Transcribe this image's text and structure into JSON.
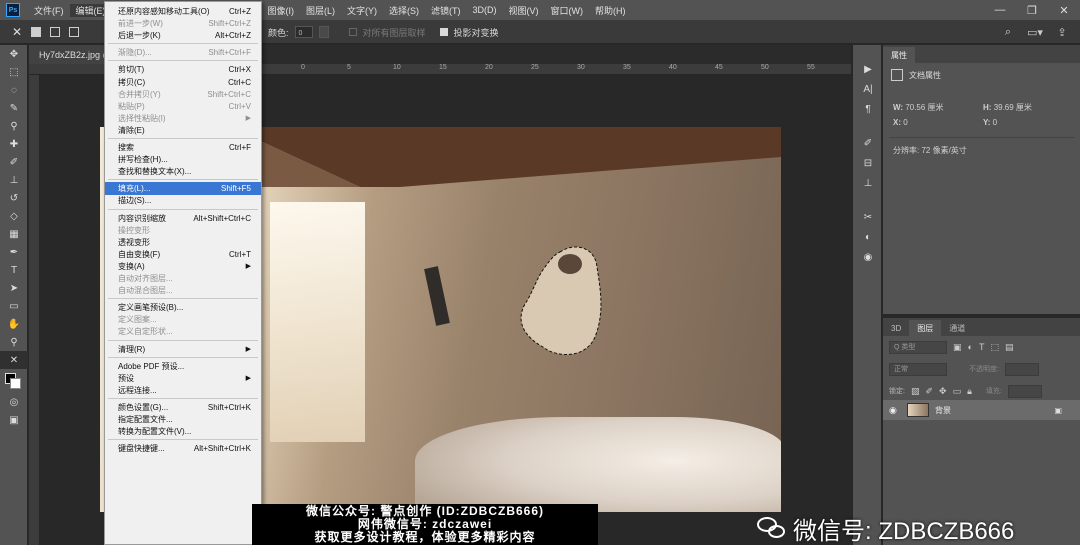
{
  "app": {
    "logo": "Ps"
  },
  "menubar": {
    "items": [
      "文件(F)",
      "编辑(E)",
      "图像(I)",
      "图层(L)",
      "文字(Y)",
      "选择(S)",
      "滤镜(T)",
      "3D(D)",
      "视图(V)",
      "窗口(W)",
      "帮助(H)"
    ],
    "window_controls": [
      "—",
      "❐",
      "✕"
    ]
  },
  "options": {
    "color_label": "颜色:",
    "color_value": "0",
    "sample_all_layers": "对所有图层取样",
    "auto_enhance": "投影对变换"
  },
  "document": {
    "tab_title": "Hy7dxZB2z.jpg @",
    "close": "×"
  },
  "ruler_numbers": [
    "0",
    "5",
    "10",
    "15",
    "20",
    "25",
    "30",
    "35",
    "40",
    "45",
    "50",
    "55",
    "60",
    "65",
    "70"
  ],
  "edit_menu": {
    "items": [
      {
        "label": "还原内容感知移动工具(O)",
        "shortcut": "Ctrl+Z",
        "disabled": false
      },
      {
        "label": "前进一步(W)",
        "shortcut": "Shift+Ctrl+Z",
        "disabled": true
      },
      {
        "label": "后退一步(K)",
        "shortcut": "Alt+Ctrl+Z",
        "disabled": false
      },
      {
        "sep": true
      },
      {
        "label": "渐隐(D)...",
        "shortcut": "Shift+Ctrl+F",
        "disabled": true
      },
      {
        "sep": true
      },
      {
        "label": "剪切(T)",
        "shortcut": "Ctrl+X",
        "disabled": false
      },
      {
        "label": "拷贝(C)",
        "shortcut": "Ctrl+C",
        "disabled": false
      },
      {
        "label": "合并拷贝(Y)",
        "shortcut": "Shift+Ctrl+C",
        "disabled": true
      },
      {
        "label": "粘贴(P)",
        "shortcut": "Ctrl+V",
        "disabled": true
      },
      {
        "label": "选择性粘贴(I)",
        "shortcut": "",
        "disabled": true,
        "submenu": true
      },
      {
        "label": "清除(E)",
        "shortcut": "",
        "disabled": false
      },
      {
        "sep": true
      },
      {
        "label": "搜索",
        "shortcut": "Ctrl+F",
        "disabled": false
      },
      {
        "label": "拼写检查(H)...",
        "shortcut": "",
        "disabled": false
      },
      {
        "label": "查找和替换文本(X)...",
        "shortcut": "",
        "disabled": false
      },
      {
        "sep": true
      },
      {
        "label": "填充(L)...",
        "shortcut": "Shift+F5",
        "disabled": false,
        "highlight": true
      },
      {
        "label": "描边(S)...",
        "shortcut": "",
        "disabled": false
      },
      {
        "sep": true
      },
      {
        "label": "内容识别缩放",
        "shortcut": "Alt+Shift+Ctrl+C",
        "disabled": false
      },
      {
        "label": "操控变形",
        "shortcut": "",
        "disabled": true
      },
      {
        "label": "透视变形",
        "shortcut": "",
        "disabled": false
      },
      {
        "label": "自由变换(F)",
        "shortcut": "Ctrl+T",
        "disabled": false
      },
      {
        "label": "变换(A)",
        "shortcut": "",
        "disabled": false,
        "submenu": true
      },
      {
        "label": "自动对齐图层...",
        "shortcut": "",
        "disabled": true
      },
      {
        "label": "自动混合图层...",
        "shortcut": "",
        "disabled": true
      },
      {
        "sep": true
      },
      {
        "label": "定义画笔预设(B)...",
        "shortcut": "",
        "disabled": false
      },
      {
        "label": "定义图案...",
        "shortcut": "",
        "disabled": true
      },
      {
        "label": "定义自定形状...",
        "shortcut": "",
        "disabled": true
      },
      {
        "sep": true
      },
      {
        "label": "清理(R)",
        "shortcut": "",
        "disabled": false,
        "submenu": true
      },
      {
        "sep": true
      },
      {
        "label": "Adobe PDF 预设...",
        "shortcut": "",
        "disabled": false
      },
      {
        "label": "预设",
        "shortcut": "",
        "disabled": false,
        "submenu": true
      },
      {
        "label": "远程连接...",
        "shortcut": "",
        "disabled": false
      },
      {
        "sep": true
      },
      {
        "label": "颜色设置(G)...",
        "shortcut": "Shift+Ctrl+K",
        "disabled": false
      },
      {
        "label": "指定配置文件...",
        "shortcut": "",
        "disabled": false
      },
      {
        "label": "转换为配置文件(V)...",
        "shortcut": "",
        "disabled": false
      },
      {
        "sep": true
      },
      {
        "label": "键盘快捷键...",
        "shortcut": "Alt+Shift+Ctrl+K",
        "disabled": false
      }
    ]
  },
  "properties": {
    "tab": "属性",
    "header": "文档属性",
    "w_label": "W:",
    "w_value": "70.56 厘米",
    "h_label": "H:",
    "h_value": "39.69 厘米",
    "x_label": "X:",
    "x_value": "0",
    "y_label": "Y:",
    "y_value": "0",
    "resolution": "分辨率: 72 像素/英寸"
  },
  "layers_panel": {
    "tabs": [
      "3D",
      "图层",
      "通道"
    ],
    "kind_placeholder": "Q 类型",
    "blend_mode": "正常",
    "opacity_label": "不透明度:",
    "lock_label": "锁定:",
    "fill_label": "填充:",
    "layer_name": "背景"
  },
  "overlay": {
    "promo_lines": [
      "微信公众号: 警点创作 (ID:ZDBCZB666)",
      "网伟微信号: zdczawei",
      "获取更多设计教程，体验更多精彩内容"
    ],
    "watermark": "微信号: ZDBCZB666"
  },
  "colors": {
    "menu_bg": "#535353",
    "menu_highlight": "#3a77d3",
    "panel_bg": "#535353",
    "workspace": "#282828"
  }
}
